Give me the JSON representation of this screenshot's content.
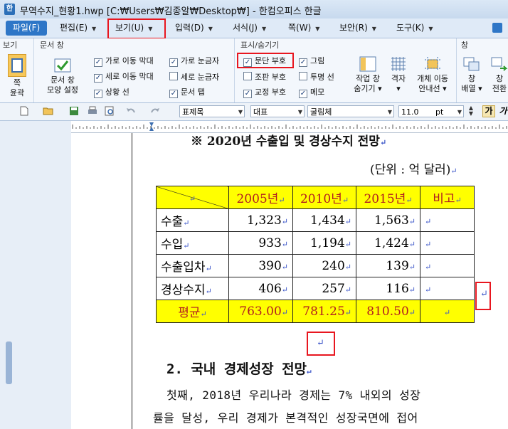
{
  "window": {
    "title": "무역수지_현황1.hwp [C:₩Users₩김종알₩Desktop₩] - 한컴오피스 한글"
  },
  "menu": {
    "file": "파일(F)",
    "tabs": [
      {
        "label": "편집(E)"
      },
      {
        "label": "보기(U)"
      },
      {
        "label": "입력(D)"
      },
      {
        "label": "서식(J)"
      },
      {
        "label": "쪽(W)"
      },
      {
        "label": "보안(R)"
      },
      {
        "label": "도구(K)"
      }
    ]
  },
  "ribbon": {
    "group_view": {
      "title": "보기",
      "fit_label_1": "쪽",
      "fit_label_2": "윤곽"
    },
    "group_docwin": {
      "title": "문서 창",
      "shape_label_1": "문서 창",
      "shape_label_2": "모양 설정"
    },
    "checks_col1": [
      {
        "label": "가로 이동 막대",
        "checked": true
      },
      {
        "label": "세로 이동 막대",
        "checked": true
      },
      {
        "label": "상황 선",
        "checked": true
      }
    ],
    "checks_col2": [
      {
        "label": "가로 눈금자",
        "checked": true
      },
      {
        "label": "세로 눈금자",
        "checked": false
      },
      {
        "label": "문서 탭",
        "checked": true
      }
    ],
    "group_show": {
      "title": "표시/숨기기"
    },
    "checks_col3": [
      {
        "label": "문단 부호",
        "checked": true
      },
      {
        "label": "조판 부호",
        "checked": false
      },
      {
        "label": "교정 부호",
        "checked": true
      }
    ],
    "checks_col4": [
      {
        "label": "그림",
        "checked": true
      },
      {
        "label": "투명 선",
        "checked": false
      },
      {
        "label": "메모",
        "checked": true
      }
    ],
    "big_buttons": [
      {
        "line1": "작업 창",
        "line2": "숨기기 ▾"
      },
      {
        "line1": "격자",
        "line2": "▾"
      },
      {
        "line1": "개체 이동",
        "line2": "안내선 ▾"
      }
    ],
    "group_window": {
      "title": "창",
      "arrange_1": "창",
      "arrange_2": "배열 ▾",
      "switch_1": "창",
      "switch_2": "전환"
    }
  },
  "toolbar": {
    "style": "표제목",
    "lang": "대표",
    "font": "굴림체",
    "size": "11.0",
    "unit": "pt",
    "bold": "가",
    "italic": "가"
  },
  "document": {
    "heading": "※ 2020년 수출입 및 경상수지 전망",
    "unit_note": "(단위 : 억 달러)",
    "para_mark": "↵",
    "table": {
      "headers": [
        "2005년",
        "2010년",
        "2015년",
        "비고"
      ],
      "rows": [
        {
          "label": "수출",
          "values": [
            "1,323",
            "1,434",
            "1,563"
          ],
          "note": ""
        },
        {
          "label": "수입",
          "values": [
            "933",
            "1,194",
            "1,424"
          ],
          "note": ""
        },
        {
          "label": "수출입차",
          "values": [
            "390",
            "240",
            "139"
          ],
          "note": ""
        },
        {
          "label": "경상수지",
          "values": [
            "406",
            "257",
            "116"
          ],
          "note": ""
        }
      ],
      "average": {
        "label": "평균",
        "values": [
          "763.00",
          "781.25",
          "810.50"
        ],
        "note": ""
      }
    },
    "section_title": "2. 국내 경제성장 전망",
    "body_line1": "첫째, 2018년 우리나라 경제는 7% 내외의 성장",
    "body_line2": "률을 달성, 우리 경제가 본격적인 성장국면에 접어"
  },
  "colors": {
    "highlight": "#ffff00",
    "accent_red": "#e8161f",
    "table_text": "#b11d20",
    "para_mark": "#3a54c8"
  }
}
